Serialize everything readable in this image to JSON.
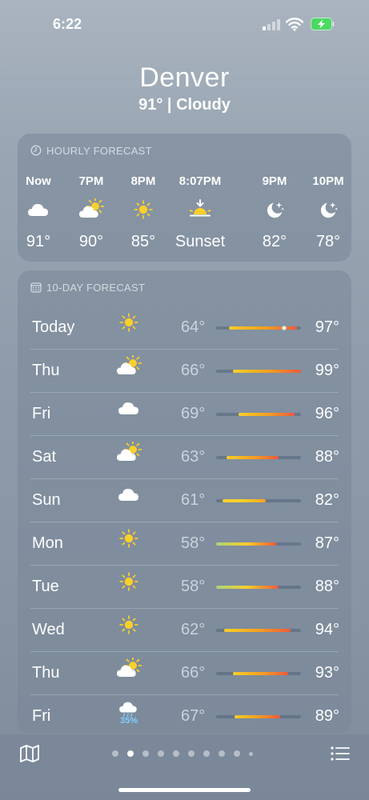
{
  "status_bar": {
    "time": "6:22"
  },
  "header": {
    "city": "Denver",
    "condition": "91° | Cloudy"
  },
  "hourly": {
    "heading": "HOURLY FORECAST",
    "hours": [
      {
        "label": "Now",
        "icon": "cloud-icon",
        "temp": "91°"
      },
      {
        "label": "7PM",
        "icon": "partly-sunny-icon",
        "temp": "90°"
      },
      {
        "label": "8PM",
        "icon": "sun-icon",
        "temp": "85°"
      },
      {
        "label": "8:07PM",
        "icon": "sunset-icon",
        "temp": "Sunset"
      },
      {
        "label": "9PM",
        "icon": "moon-stars-icon",
        "temp": "82°"
      },
      {
        "label": "10PM",
        "icon": "moon-stars-icon",
        "temp": "78°"
      }
    ]
  },
  "daily": {
    "heading": "10-DAY FORECAST",
    "range_min": 58,
    "range_max": 99,
    "days": [
      {
        "day": "Today",
        "icon": "sun-icon",
        "low": "64°",
        "high": "97°",
        "lo": 64,
        "hi": 97,
        "current": 91
      },
      {
        "day": "Thu",
        "icon": "partly-sunny-icon",
        "low": "66°",
        "high": "99°",
        "lo": 66,
        "hi": 99
      },
      {
        "day": "Fri",
        "icon": "cloud-icon",
        "low": "69°",
        "high": "96°",
        "lo": 69,
        "hi": 96
      },
      {
        "day": "Sat",
        "icon": "partly-sunny-icon",
        "low": "63°",
        "high": "88°",
        "lo": 63,
        "hi": 88
      },
      {
        "day": "Sun",
        "icon": "cloud-icon",
        "low": "61°",
        "high": "82°",
        "lo": 61,
        "hi": 82
      },
      {
        "day": "Mon",
        "icon": "sun-icon",
        "low": "58°",
        "high": "87°",
        "lo": 58,
        "hi": 87
      },
      {
        "day": "Tue",
        "icon": "sun-icon",
        "low": "58°",
        "high": "88°",
        "lo": 58,
        "hi": 88
      },
      {
        "day": "Wed",
        "icon": "sun-icon",
        "low": "62°",
        "high": "94°",
        "lo": 62,
        "hi": 94
      },
      {
        "day": "Thu",
        "icon": "partly-sunny-icon",
        "low": "66°",
        "high": "93°",
        "lo": 66,
        "hi": 93
      },
      {
        "day": "Fri",
        "icon": "rain-icon",
        "precip": "35%",
        "low": "67°",
        "high": "89°",
        "lo": 67,
        "hi": 89
      }
    ]
  },
  "bottom_bar": {
    "pages": 10,
    "active_page": 1
  },
  "colors": {
    "sun": "#f9cf2a",
    "precip": "#7fd0ff",
    "hot": "#ef5a3c",
    "warm": "#f4a21e",
    "mild": "#a8d47a"
  }
}
